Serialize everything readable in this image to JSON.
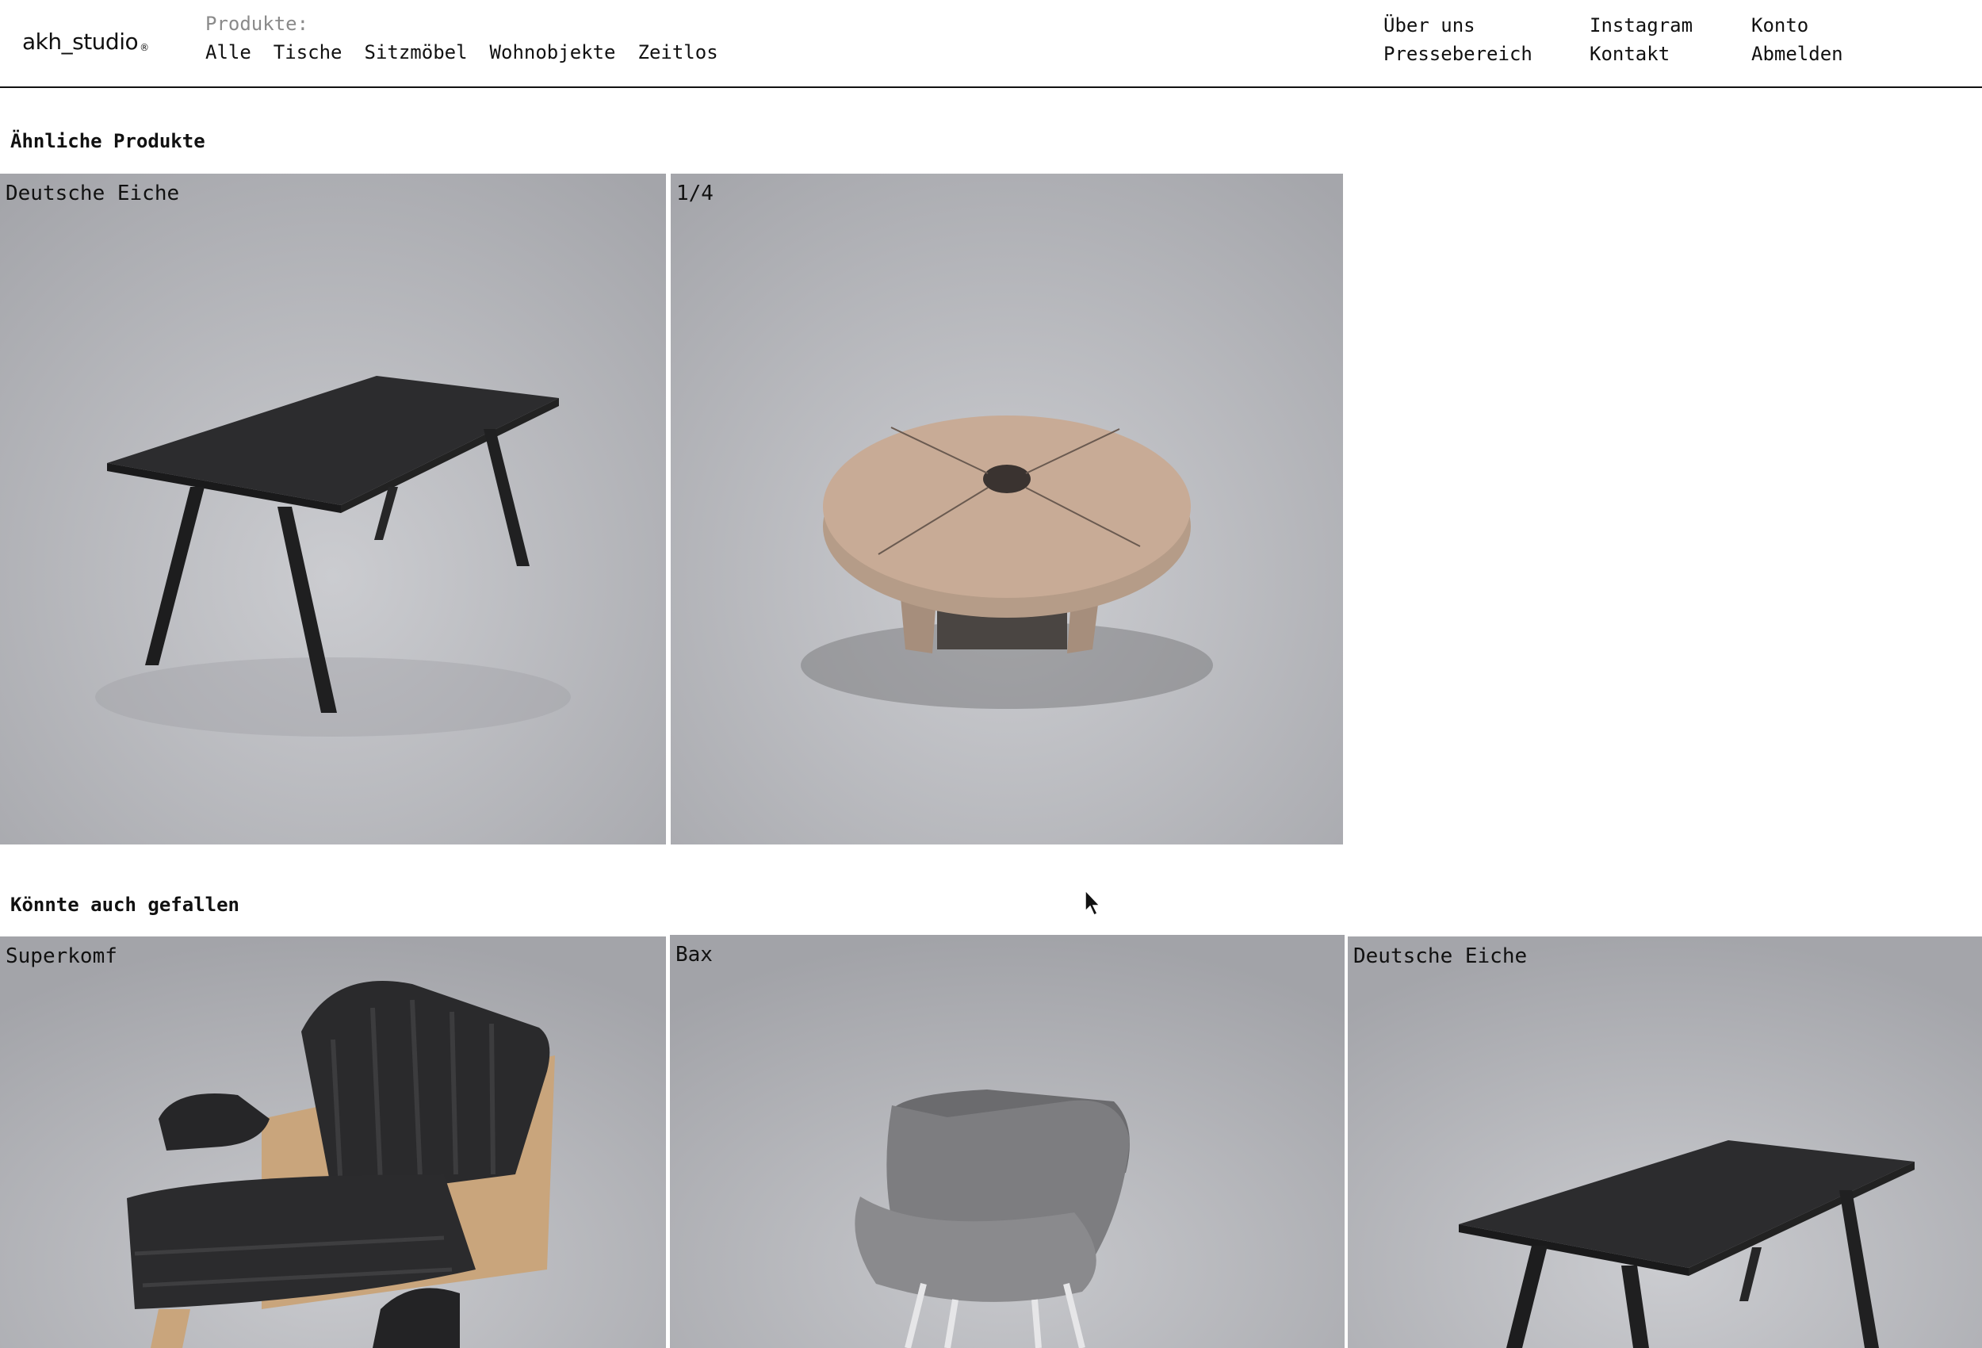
{
  "brand": {
    "logo_text": "akh_studio",
    "logo_mark": "®"
  },
  "nav": {
    "caption": "Produkte:",
    "items": [
      "Alle",
      "Tische",
      "Sitzmöbel",
      "Wohnobjekte",
      "Zeitlos"
    ]
  },
  "meta": {
    "col1": [
      "Über uns",
      "Pressebereich"
    ],
    "col2": [
      "Instagram",
      "Kontakt"
    ],
    "col3": [
      "Konto",
      "Abmelden"
    ]
  },
  "sections": {
    "similar": {
      "title": "Ähnliche Produkte",
      "cards": [
        {
          "label": "Deutsche Eiche",
          "kind": "dark-table"
        },
        {
          "label": "1/4",
          "kind": "round-table"
        }
      ]
    },
    "also_like": {
      "title": "Könnte auch gefallen",
      "cards": [
        {
          "label": "Superkomf",
          "kind": "lounge-chair"
        },
        {
          "label": "Bax",
          "kind": "grey-chair",
          "selected": true
        },
        {
          "label": "Deutsche Eiche",
          "kind": "dark-table"
        }
      ]
    }
  },
  "colors": {
    "bg_grey": "#b6b7bc",
    "text": "#111111",
    "caption_grey": "#8a8a8a",
    "round_table": "#c8ab96"
  }
}
